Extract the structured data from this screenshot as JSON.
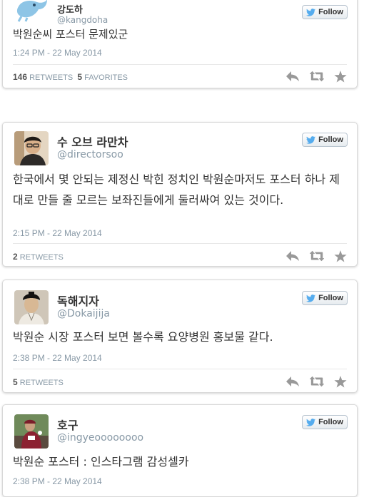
{
  "tweets": [
    {
      "name": "강도하",
      "handle": "@kangdoha",
      "text": "박원순씨 포스터 문제있군",
      "time": "1:24 PM - 22 May 2014",
      "retweets_count": "146",
      "retweets_label": "RETWEETS",
      "favorites_count": "5",
      "favorites_label": "FAVORITES"
    },
    {
      "name": "수 오브 라만차",
      "handle": "@directorsoo",
      "text": "한국에서 몇 안되는 제정신 박힌 정치인 박원순마저도 포스터 하나 제대로 만들 줄 모르는 보좌진들에게 둘러싸여 있는 것이다.",
      "time": "2:15 PM - 22 May 2014",
      "retweets_count": "2",
      "retweets_label": "RETWEETS"
    },
    {
      "name": "독해지자",
      "handle": "@Dokaijija",
      "text": "박원순 시장 포스터 보면 볼수록 요양병원 홍보물 같다.",
      "time": "2:38 PM - 22 May 2014",
      "retweets_count": "5",
      "retweets_label": "RETWEETS"
    },
    {
      "name": "호구",
      "handle": "@ingyeoooooooo",
      "text": "박원순 포스터 : 인스타그램 감성셀카",
      "time": "2:38 PM - 22 May 2014"
    }
  ],
  "follow_label": "Follow",
  "colors": {
    "twitter_blue": "#55acee",
    "meta_gray": "#8899a6",
    "action_gray": "#999999"
  },
  "icons": [
    "twitter-bird-icon",
    "reply-icon",
    "retweet-icon",
    "favorite-star-icon"
  ]
}
